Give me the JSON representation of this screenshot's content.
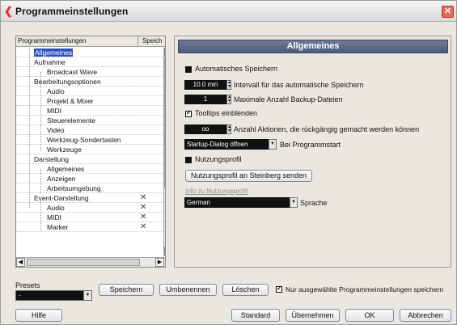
{
  "window": {
    "title": "Programmeinstellungen",
    "close_glyph": "✕"
  },
  "tree": {
    "header_name": "Programmeinstellungen",
    "header_save": "Speich",
    "items": [
      {
        "label": "Allgemeines",
        "level": 1,
        "selected": true,
        "mark": ""
      },
      {
        "label": "Aufnahme",
        "level": 1,
        "selected": false,
        "mark": ""
      },
      {
        "label": "Broadcast Wave",
        "level": 2,
        "selected": false,
        "mark": ""
      },
      {
        "label": "Bearbeitungsoptionen",
        "level": 1,
        "selected": false,
        "mark": ""
      },
      {
        "label": "Audio",
        "level": 2,
        "selected": false,
        "mark": ""
      },
      {
        "label": "Projekt & Mixer",
        "level": 2,
        "selected": false,
        "mark": ""
      },
      {
        "label": "MIDI",
        "level": 2,
        "selected": false,
        "mark": ""
      },
      {
        "label": "Steuerelemente",
        "level": 2,
        "selected": false,
        "mark": ""
      },
      {
        "label": "Video",
        "level": 2,
        "selected": false,
        "mark": ""
      },
      {
        "label": "Werkzeug-Sondertasten",
        "level": 2,
        "selected": false,
        "mark": ""
      },
      {
        "label": "Werkzeuge",
        "level": 2,
        "selected": false,
        "mark": ""
      },
      {
        "label": "Darstellung",
        "level": 1,
        "selected": false,
        "mark": ""
      },
      {
        "label": "Allgemeines",
        "level": 2,
        "selected": false,
        "mark": ""
      },
      {
        "label": "Anzeigen",
        "level": 2,
        "selected": false,
        "mark": ""
      },
      {
        "label": "Arbeitsumgebung",
        "level": 2,
        "selected": false,
        "mark": ""
      },
      {
        "label": "Event-Darstellung",
        "level": 1,
        "selected": false,
        "mark": "✕"
      },
      {
        "label": "Audio",
        "level": 2,
        "selected": false,
        "mark": "✕"
      },
      {
        "label": "MIDI",
        "level": 2,
        "selected": false,
        "mark": "✕"
      },
      {
        "label": "Marker",
        "level": 2,
        "selected": false,
        "mark": "✕"
      }
    ]
  },
  "panel": {
    "title": "Allgemeines",
    "auto_save_label": "Automatisches Speichern",
    "interval_value": "10.0 min",
    "interval_label": "Intervall für das automatische Speichern",
    "backup_value": "1",
    "backup_label": "Maximale Anzahl Backup-Dateien",
    "tooltips_label": "Tooltips einblenden",
    "undo_value": "oo",
    "undo_label": "Anzahl Aktionen, die rückgängig gemacht werden können",
    "startup_value": "Startup-Dialog öffnen",
    "startup_label": "Bei Programmstart",
    "usage_profile_label": "Nutzungsprofil",
    "send_profile_button": "Nutzungsprofil an Steinberg senden",
    "usage_info_link": "Info zu Nutzungsprofil",
    "language_value": "German",
    "language_label": "Sprache"
  },
  "presets": {
    "label": "Presets",
    "value": "-",
    "save_button": "Speichern",
    "rename_button": "Umbenennen",
    "delete_button": "Löschen",
    "only_selected_label": "Nur ausgewählte Programmeinstellungen speichern"
  },
  "footer": {
    "help_button": "Hilfe",
    "default_button": "Standard",
    "apply_button": "Übernehmen",
    "ok_button": "OK",
    "cancel_button": "Abbrechen"
  }
}
